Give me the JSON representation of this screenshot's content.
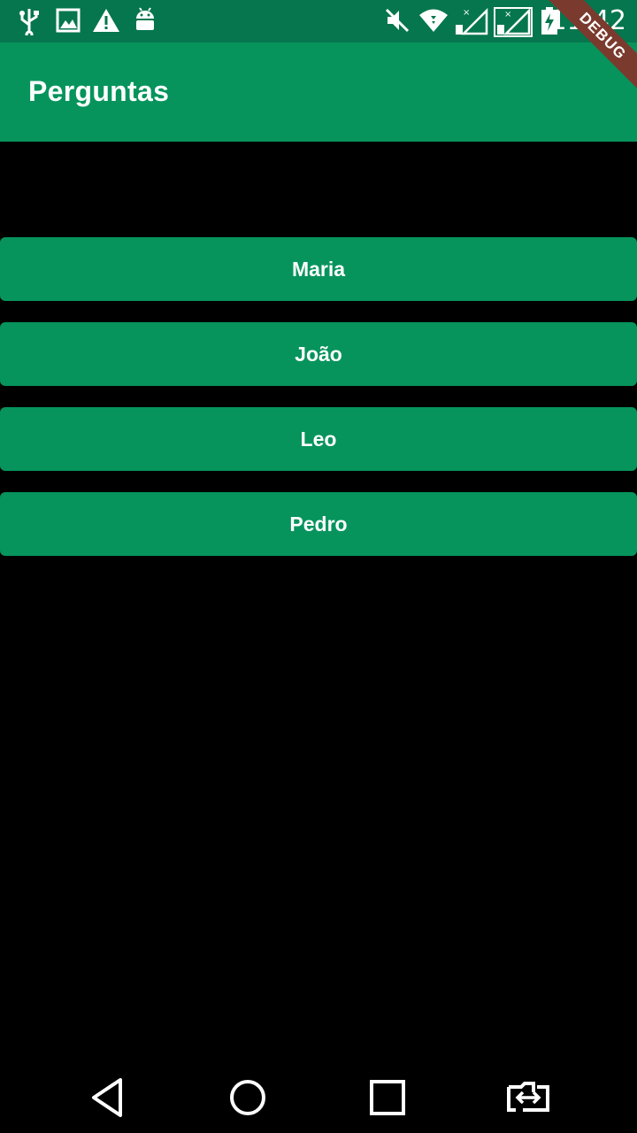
{
  "status_bar": {
    "time": "11:42",
    "icons": [
      "usb-icon",
      "image-icon",
      "warning-icon",
      "android-icon",
      "mute-icon",
      "wifi-icon",
      "signal-sim1-icon",
      "signal-sim2-icon",
      "battery-charging-icon"
    ]
  },
  "debug_banner": {
    "label": "DEBUG"
  },
  "app_bar": {
    "title": "Perguntas"
  },
  "answers": [
    {
      "label": "Maria"
    },
    {
      "label": "João"
    },
    {
      "label": "Leo"
    },
    {
      "label": "Pedro"
    }
  ],
  "nav_bar": {
    "buttons": [
      "back-icon",
      "home-icon",
      "recents-icon",
      "switch-app-icon"
    ]
  },
  "colors": {
    "primary": "#06945C",
    "status_bar": "#05764E",
    "background": "#000000",
    "debug_ribbon": "#7A3B2E"
  }
}
